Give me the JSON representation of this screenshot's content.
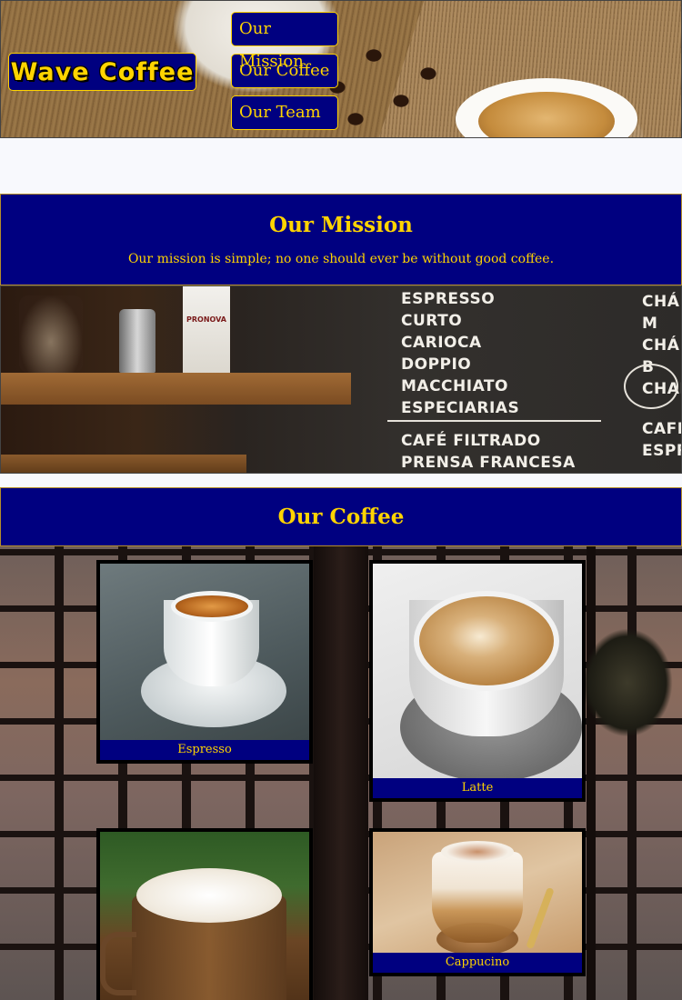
{
  "header": {
    "logo_text": "Wave Coffee",
    "nav": [
      {
        "label": "Our Mission"
      },
      {
        "label": "Our Coffee"
      },
      {
        "label": "Our Team"
      }
    ]
  },
  "mission": {
    "title": "Our Mission",
    "text": "Our mission is simple; no one should ever be without good coffee."
  },
  "menu_board": {
    "items_left": [
      "ESPRESSO",
      "CURTO",
      "CARIOCA",
      "DOPPIO",
      "MACCHIATO",
      "ESPECIARIAS"
    ],
    "items_left_lower": [
      "CAFÉ FILTRADO",
      "PRENSA FRANCESA"
    ],
    "items_right": [
      "CHÁ M",
      "CHÁ B",
      "CHAI"
    ],
    "items_right_lower": [
      "CAFÉ",
      "ESPR"
    ],
    "bag_label": "PRONOVA"
  },
  "coffee": {
    "title": "Our Coffee",
    "items": [
      {
        "name": "Espresso"
      },
      {
        "name": "Latte"
      },
      {
        "name": ""
      },
      {
        "name": "Cappucino"
      }
    ]
  },
  "colors": {
    "navy": "#000080",
    "gold": "#ffd400",
    "page_bg": "#f8f9fd"
  }
}
